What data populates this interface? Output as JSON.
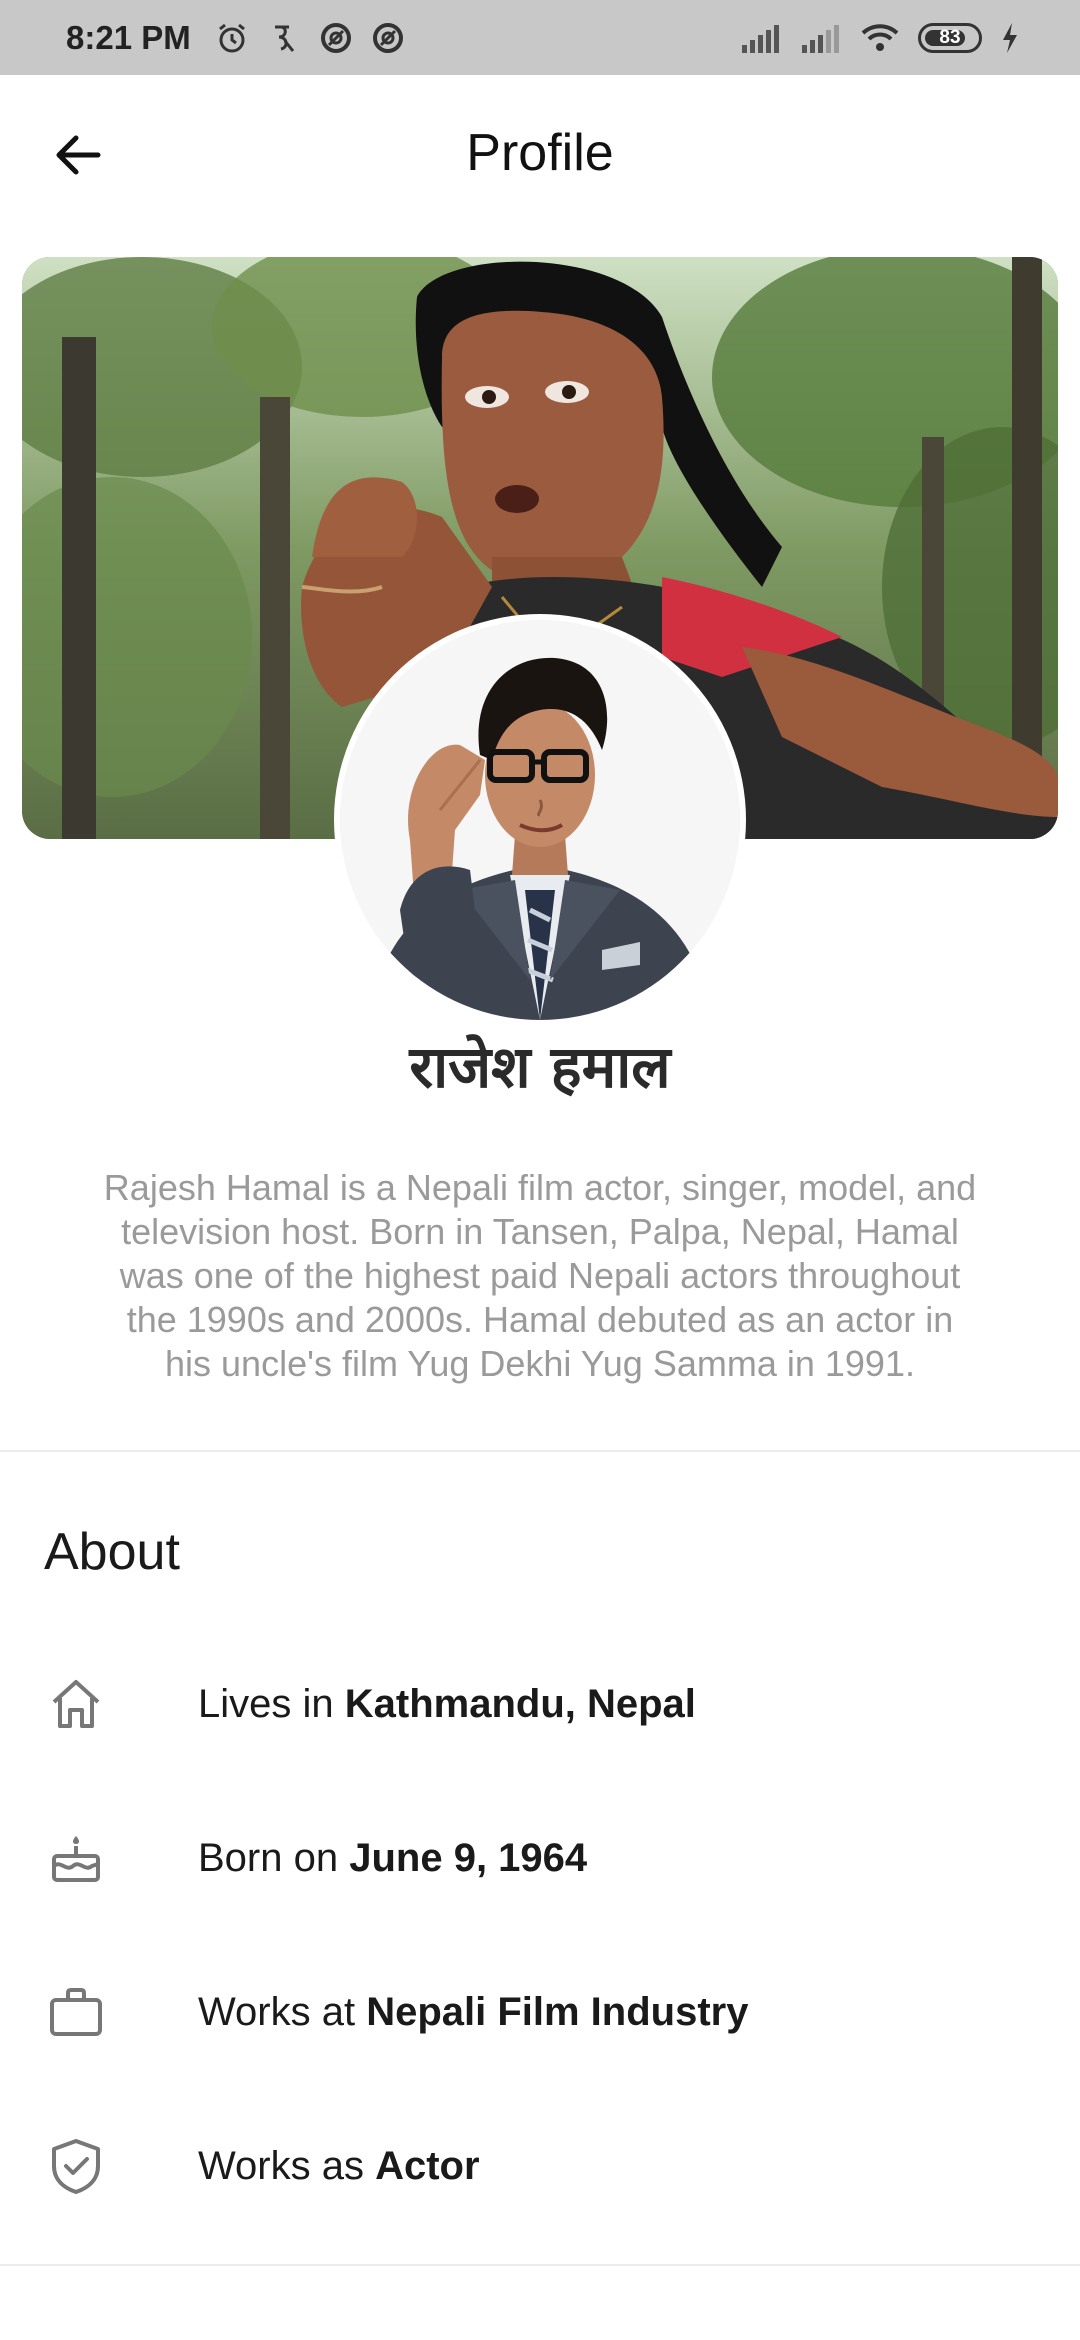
{
  "status_bar": {
    "time": "8:21 PM",
    "battery": "83"
  },
  "app_bar": {
    "title": "Profile"
  },
  "profile": {
    "name": "राजेश हमाल",
    "bio": "Rajesh Hamal is a Nepali film actor, singer, model, and television host. Born in Tansen, Palpa, Nepal, Hamal was one of the highest paid Nepali actors throughout the 1990s and 2000s. Hamal debuted as an actor in his uncle's film Yug Dekhi Yug Samma in 1991."
  },
  "about": {
    "heading": "About",
    "items": [
      {
        "icon": "home-icon",
        "prefix": "Lives in ",
        "value": "Kathmandu, Nepal"
      },
      {
        "icon": "birthday-cake-icon",
        "prefix": "Born on ",
        "value": "June 9, 1964"
      },
      {
        "icon": "briefcase-icon",
        "prefix": "Works at ",
        "value": "Nepali Film Industry"
      },
      {
        "icon": "shield-check-icon",
        "prefix": "Works as ",
        "value": "Actor"
      }
    ]
  }
}
